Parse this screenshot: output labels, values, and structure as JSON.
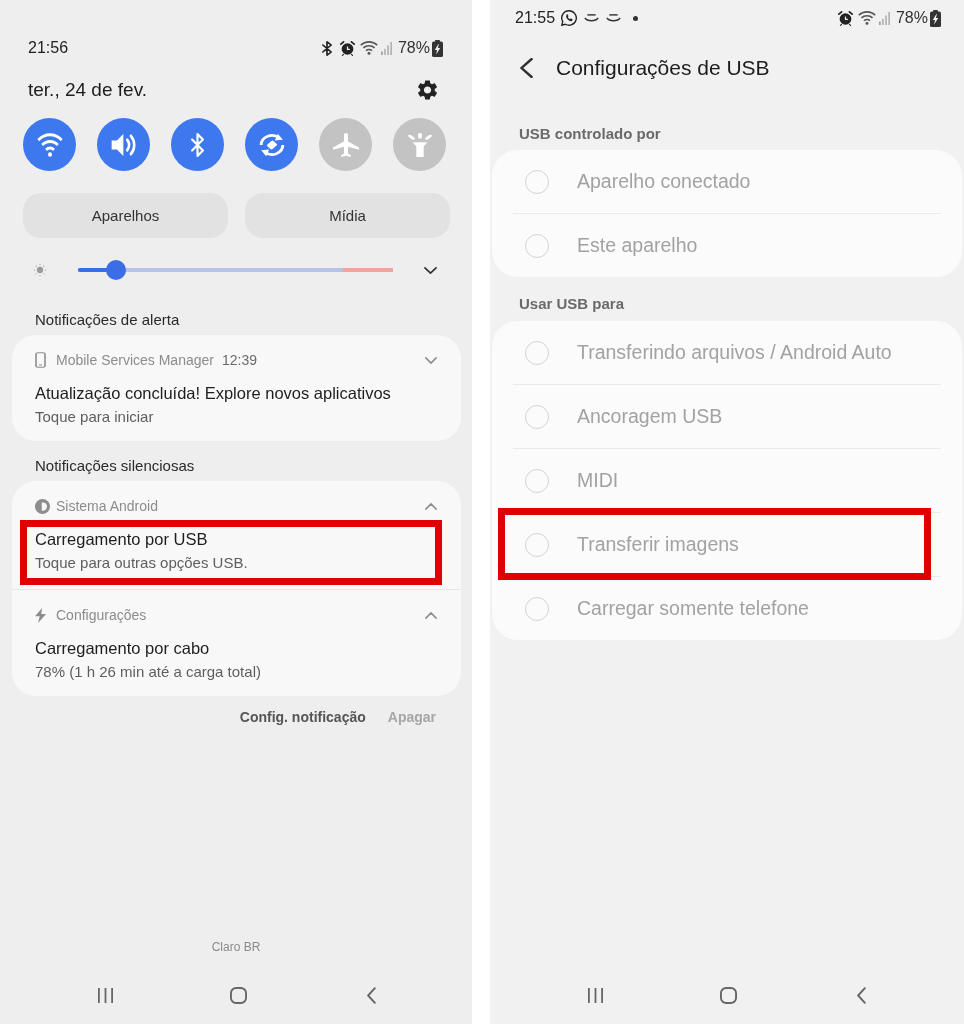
{
  "notification_panel": {
    "status_bar": {
      "time": "21:56",
      "battery": "78%"
    },
    "date": "ter., 24 de fev.",
    "quick_toggles": [
      {
        "on": true
      },
      {
        "on": true
      },
      {
        "on": true
      },
      {
        "on": true
      },
      {
        "on": false
      },
      {
        "on": false
      }
    ],
    "buttons": [
      "Aparelhos",
      "Mídia"
    ],
    "brightness": {
      "level": 0.12
    },
    "sections": [
      {
        "title": "Notificações de alerta",
        "notifications": [
          {
            "app": "Mobile Services Manager",
            "time": "12:39",
            "expanded": false,
            "title": "Atualização concluída! Explore novos aplicativos",
            "text": "Toque para iniciar",
            "highlighted": false
          }
        ]
      },
      {
        "title": "Notificações silenciosas",
        "notifications": [
          {
            "app": "Sistema Android",
            "expanded": true,
            "title": "Carregamento por USB",
            "text": "Toque para outras opções USB.",
            "highlighted": true
          },
          {
            "app": "Configurações",
            "expanded": true,
            "title": "Carregamento por cabo",
            "text": "78% (1 h 26 min até a carga total)",
            "highlighted": false
          }
        ]
      }
    ],
    "footer": {
      "settings_link": "Config. notificação",
      "clear_button": {
        "label": "Apagar",
        "disabled": true
      }
    },
    "carrier": "Claro BR"
  },
  "usb_settings": {
    "status_bar": {
      "time": "21:55",
      "battery": "78%"
    },
    "title": "Configurações de USB",
    "groups": [
      {
        "heading": "USB controlado por",
        "options": [
          {
            "label": "Aparelho conectado",
            "selected": false,
            "disabled": true,
            "highlighted": false
          },
          {
            "label": "Este aparelho",
            "selected": false,
            "disabled": true,
            "highlighted": false
          }
        ]
      },
      {
        "heading": "Usar USB para",
        "options": [
          {
            "label": "Transferindo arquivos / Android Auto",
            "selected": false,
            "disabled": true,
            "highlighted": false
          },
          {
            "label": "Ancoragem USB",
            "selected": false,
            "disabled": true,
            "highlighted": false
          },
          {
            "label": "MIDI",
            "selected": false,
            "disabled": true,
            "highlighted": false
          },
          {
            "label": "Transferir imagens",
            "selected": false,
            "disabled": true,
            "highlighted": true
          },
          {
            "label": "Carregar somente telefone",
            "selected": false,
            "disabled": true,
            "highlighted": false
          }
        ]
      }
    ]
  }
}
